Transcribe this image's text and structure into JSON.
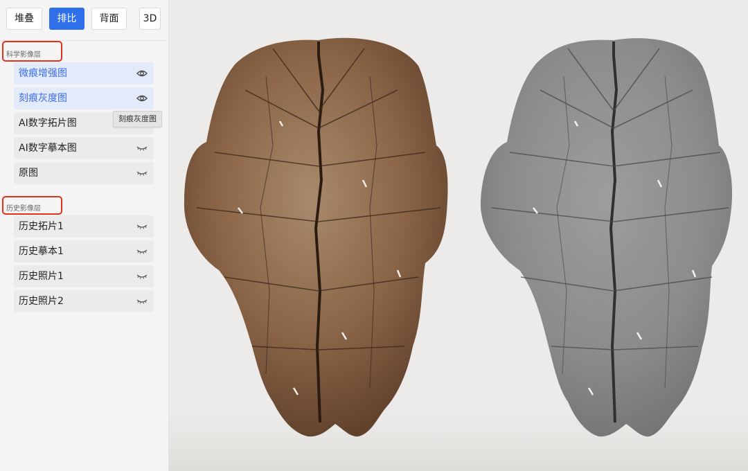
{
  "toolbar": {
    "stack": "堆叠",
    "compare": "排比",
    "back": "背面",
    "three_d": "3D"
  },
  "sections": {
    "science": {
      "title": "科学影像层"
    },
    "history": {
      "title": "历史影像层"
    }
  },
  "layers": {
    "science": [
      {
        "label": "微痕增强图",
        "visible": true
      },
      {
        "label": "刻痕灰度图",
        "visible": true
      },
      {
        "label": "AI数字拓片图",
        "visible": false
      },
      {
        "label": "AI数字摹本图",
        "visible": false
      },
      {
        "label": "原图",
        "visible": false
      }
    ],
    "history": [
      {
        "label": "历史拓片1",
        "visible": false
      },
      {
        "label": "历史摹本1",
        "visible": false
      },
      {
        "label": "历史照片1",
        "visible": false
      },
      {
        "label": "历史照片2",
        "visible": false
      }
    ]
  },
  "tooltip": {
    "text": "刻痕灰度图"
  },
  "colors": {
    "accent": "#2f6fea",
    "highlight_box": "#e0301e",
    "shell_color": "#8a6446",
    "shell_gray": "#8c8c8c"
  },
  "icons": {
    "visible": "eye-icon",
    "hidden": "eye-closed-icon"
  }
}
